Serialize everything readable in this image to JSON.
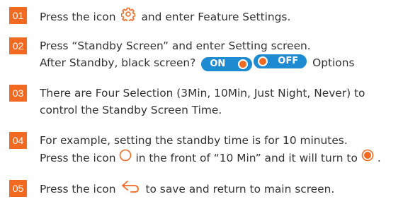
{
  "steps": [
    {
      "number": "01",
      "line1_a": "Press the icon",
      "line1_icon": "gear-icon",
      "line1_b": "and enter Feature Settings."
    },
    {
      "number": "02",
      "line1": "Press “Standby Screen” and enter Setting screen.",
      "line2_a": "After Standby, black screen?",
      "toggle_on_label": "ON",
      "toggle_off_label": "OFF",
      "line2_b": "Options"
    },
    {
      "number": "03",
      "line1": "There are Four Selection (3Min, 10Min, Just Night, Never) to",
      "line2": "control the Standby Screen Time."
    },
    {
      "number": "04",
      "line1": "For example, setting the standby time is for 10 minutes.",
      "line2_a": "Press the icon",
      "line2_icon_1": "radio-empty-icon",
      "line2_b": "in the front of “10 Min” and it will turn to",
      "line2_icon_2": "radio-selected-icon",
      "line2_c": "."
    },
    {
      "number": "05",
      "line1_a": "Press the icon",
      "line1_icon": "back-arrow-icon",
      "line1_b": "to save and return to main screen."
    }
  ],
  "colors": {
    "accent": "#f26a21",
    "toggle_blue": "#1e8ad2",
    "text": "#333333"
  }
}
